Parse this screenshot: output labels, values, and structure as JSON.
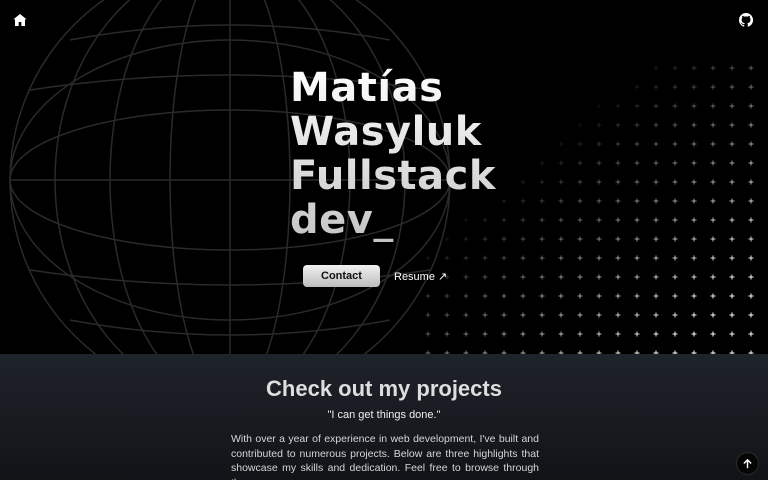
{
  "nav": {
    "home_icon": "home-icon",
    "github_icon": "github-icon"
  },
  "hero": {
    "title_lines": [
      "Matías",
      "Wasyluk",
      "Fullstack",
      "dev_"
    ],
    "contact_label": "Contact",
    "resume_label": "Resume ↗"
  },
  "projects": {
    "title": "Check out my projects",
    "quote": "\"I can get things done.\"",
    "description": "With over a year of experience in web development, I've built and contributed to numerous projects. Below are three highlights that showcase my skills and dedication. Feel free to browse through them."
  },
  "colors": {
    "background": "#000000",
    "section_background": "#1f232a",
    "button_light": "#e6e6e6",
    "text": "#dcdcdc"
  },
  "scroll_top_icon": "arrow-up-icon"
}
